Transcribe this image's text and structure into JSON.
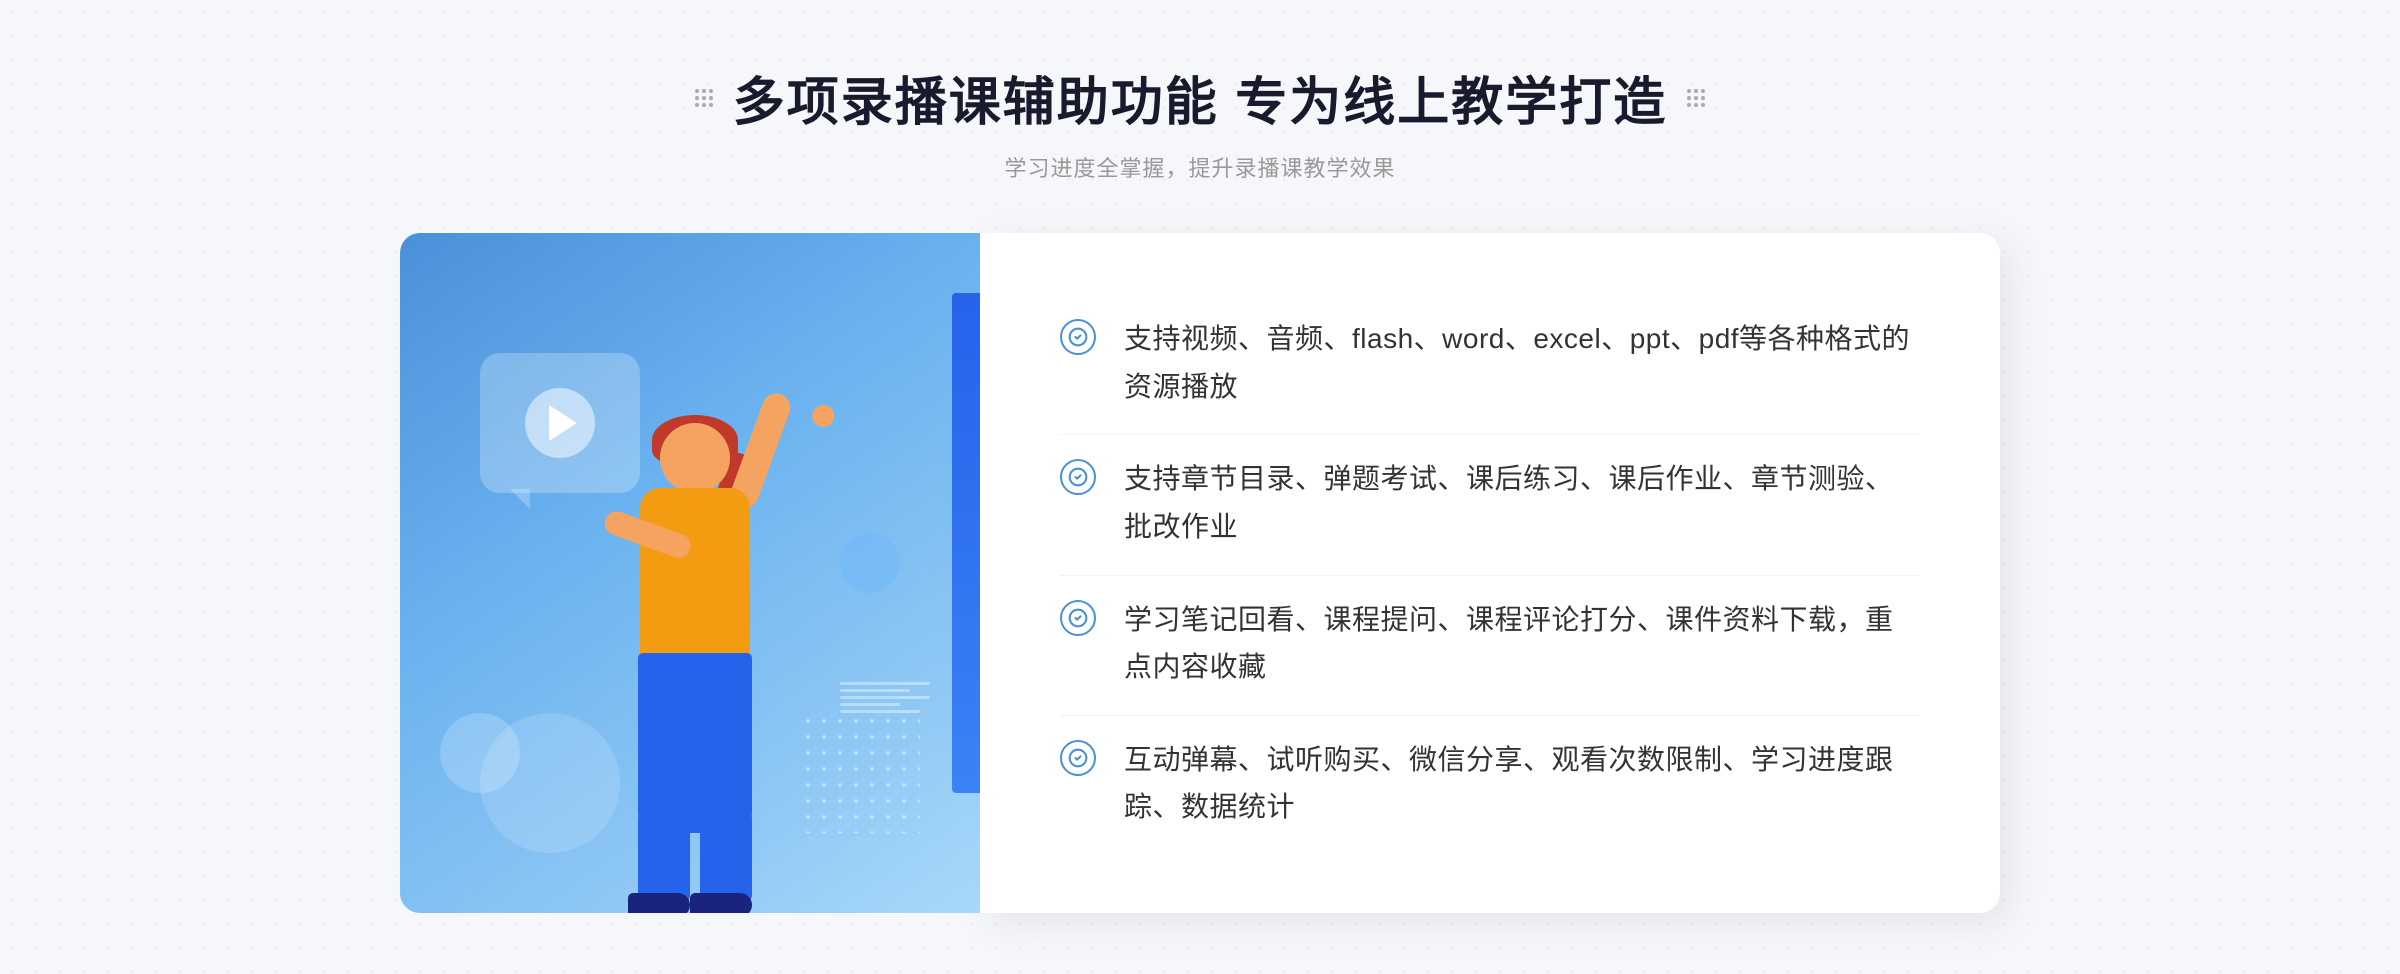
{
  "page": {
    "background_color": "#f5f7fa"
  },
  "header": {
    "title": "多项录播课辅助功能 专为线上教学打造",
    "subtitle": "学习进度全掌握，提升录播课教学效果",
    "decoration_dots": "·· ··"
  },
  "features": [
    {
      "id": "feature-1",
      "text": "支持视频、音频、flash、word、excel、ppt、pdf等各种格式的资源播放"
    },
    {
      "id": "feature-2",
      "text": "支持章节目录、弹题考试、课后练习、课后作业、章节测验、批改作业"
    },
    {
      "id": "feature-3",
      "text": "学习笔记回看、课程提问、课程评论打分、课件资料下载，重点内容收藏"
    },
    {
      "id": "feature-4",
      "text": "互动弹幕、试听购买、微信分享、观看次数限制、学习进度跟踪、数据统计"
    }
  ],
  "illustration": {
    "play_icon": "▶",
    "chevron_left": "»"
  }
}
